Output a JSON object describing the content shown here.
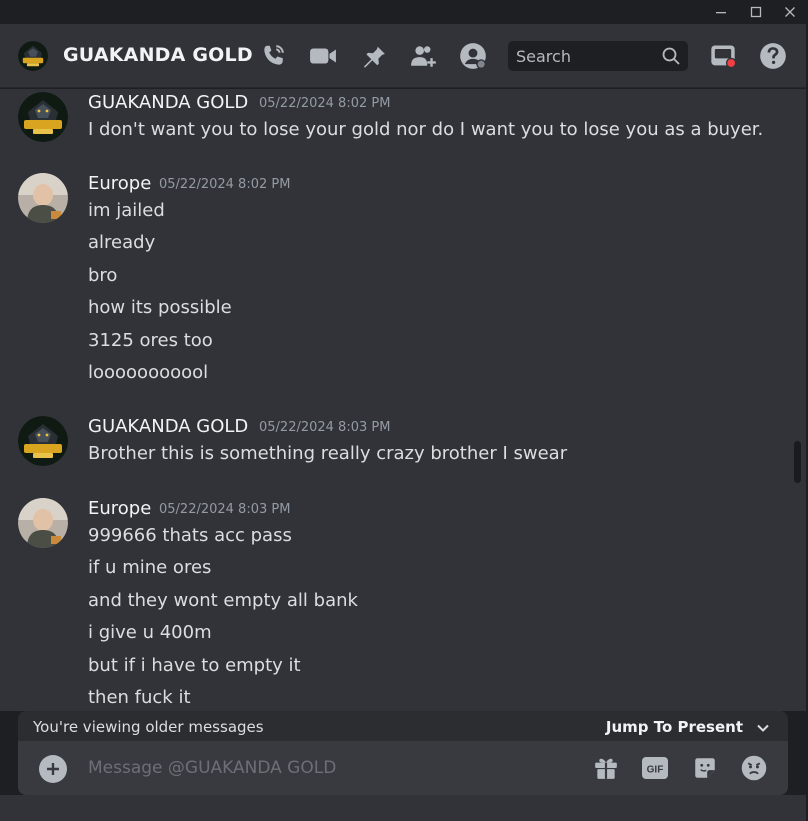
{
  "window": {
    "minimize_icon": "minimize-icon",
    "maximize_icon": "maximize-icon",
    "close_icon": "close-icon"
  },
  "header": {
    "title": "GUAKANDA GOLD",
    "search_placeholder": "Search",
    "icons": [
      "voice-call-icon",
      "video-call-icon",
      "pin-icon",
      "add-friends-icon",
      "user-profile-icon",
      "search-icon",
      "inbox-icon",
      "help-icon"
    ]
  },
  "messages": [
    {
      "author": "GUAKANDA GOLD",
      "timestamp": "05/22/2024 8:02 PM",
      "avatar": "guakanda-gold-avatar",
      "lines": [
        "I don't want you to lose your gold nor do I want you to lose you as a buyer."
      ]
    },
    {
      "author": "Europe",
      "timestamp": "05/22/2024 8:02 PM",
      "avatar": "europe-avatar",
      "lines": [
        "im jailed",
        "already",
        "bro",
        "how its possible",
        "3125 ores too",
        "looooooooool"
      ]
    },
    {
      "author": "GUAKANDA GOLD",
      "timestamp": "05/22/2024 8:03 PM",
      "avatar": "guakanda-gold-avatar",
      "lines": [
        "Brother this is something really crazy brother I swear"
      ]
    },
    {
      "author": "Europe",
      "timestamp": "05/22/2024 8:03 PM",
      "avatar": "europe-avatar",
      "lines": [
        "999666 thats acc pass",
        "if u mine ores",
        "and they wont empty all bank",
        "i give u 400m",
        "but if i have to empty it",
        "then fuck it"
      ]
    }
  ],
  "older_bar": {
    "text": "You're viewing older messages",
    "jump_label": "Jump To Present"
  },
  "composer": {
    "placeholder": "Message @GUAKANDA GOLD",
    "gif_label": "GIF"
  },
  "colors": {
    "background": "#313338",
    "titlebar": "#1e1f22",
    "composer": "#383a40",
    "notification_dot": "#f23f43"
  }
}
